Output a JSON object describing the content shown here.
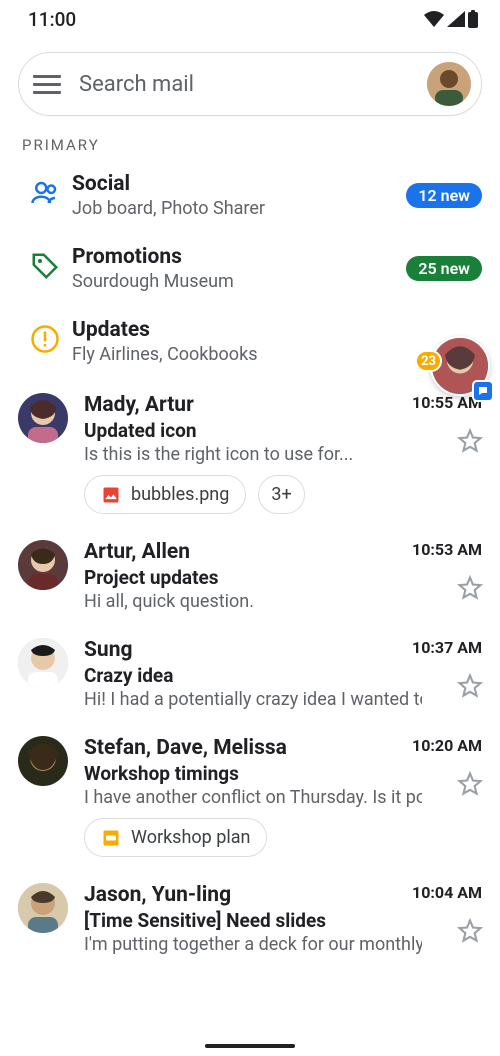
{
  "status": {
    "time": "11:00"
  },
  "search": {
    "placeholder": "Search mail"
  },
  "section": {
    "label": "PRIMARY"
  },
  "categories": [
    {
      "title": "Social",
      "subtitle": "Job board, Photo Sharer",
      "badge": "12 new",
      "badgeColor": "blue",
      "icon": "people"
    },
    {
      "title": "Promotions",
      "subtitle": "Sourdough Museum",
      "badge": "25 new",
      "badgeColor": "green",
      "icon": "tag"
    },
    {
      "title": "Updates",
      "subtitle": "Fly Airlines, Cookbooks",
      "badge": "",
      "badgeColor": "",
      "icon": "info"
    }
  ],
  "floating": {
    "count": "23"
  },
  "emails": [
    {
      "senders": "Mady, Artur",
      "subject": "Updated icon",
      "snippet": "Is this is the right icon to use for...",
      "time": "10:55 AM",
      "attachments": [
        {
          "kind": "image",
          "label": "bubbles.png"
        }
      ],
      "extra": "3+"
    },
    {
      "senders": "Artur, Allen",
      "subject": "Project updates",
      "snippet": "Hi all, quick question.",
      "time": "10:53 AM"
    },
    {
      "senders": "Sung",
      "subject": "Crazy idea",
      "snippet": "Hi! I had a potentially crazy idea I wanted to...",
      "time": "10:37 AM"
    },
    {
      "senders": "Stefan, Dave, Melissa",
      "subject": "Workshop timings",
      "snippet": "I have another conflict on Thursday. Is it po...",
      "time": "10:20 AM",
      "attachments": [
        {
          "kind": "slides",
          "label": "Workshop plan"
        }
      ]
    },
    {
      "senders": "Jason, Yun-ling",
      "subject": "[Time Sensitive] Need slides",
      "snippet": "I'm putting together a deck for our monthly...",
      "time": "10:04 AM"
    }
  ]
}
